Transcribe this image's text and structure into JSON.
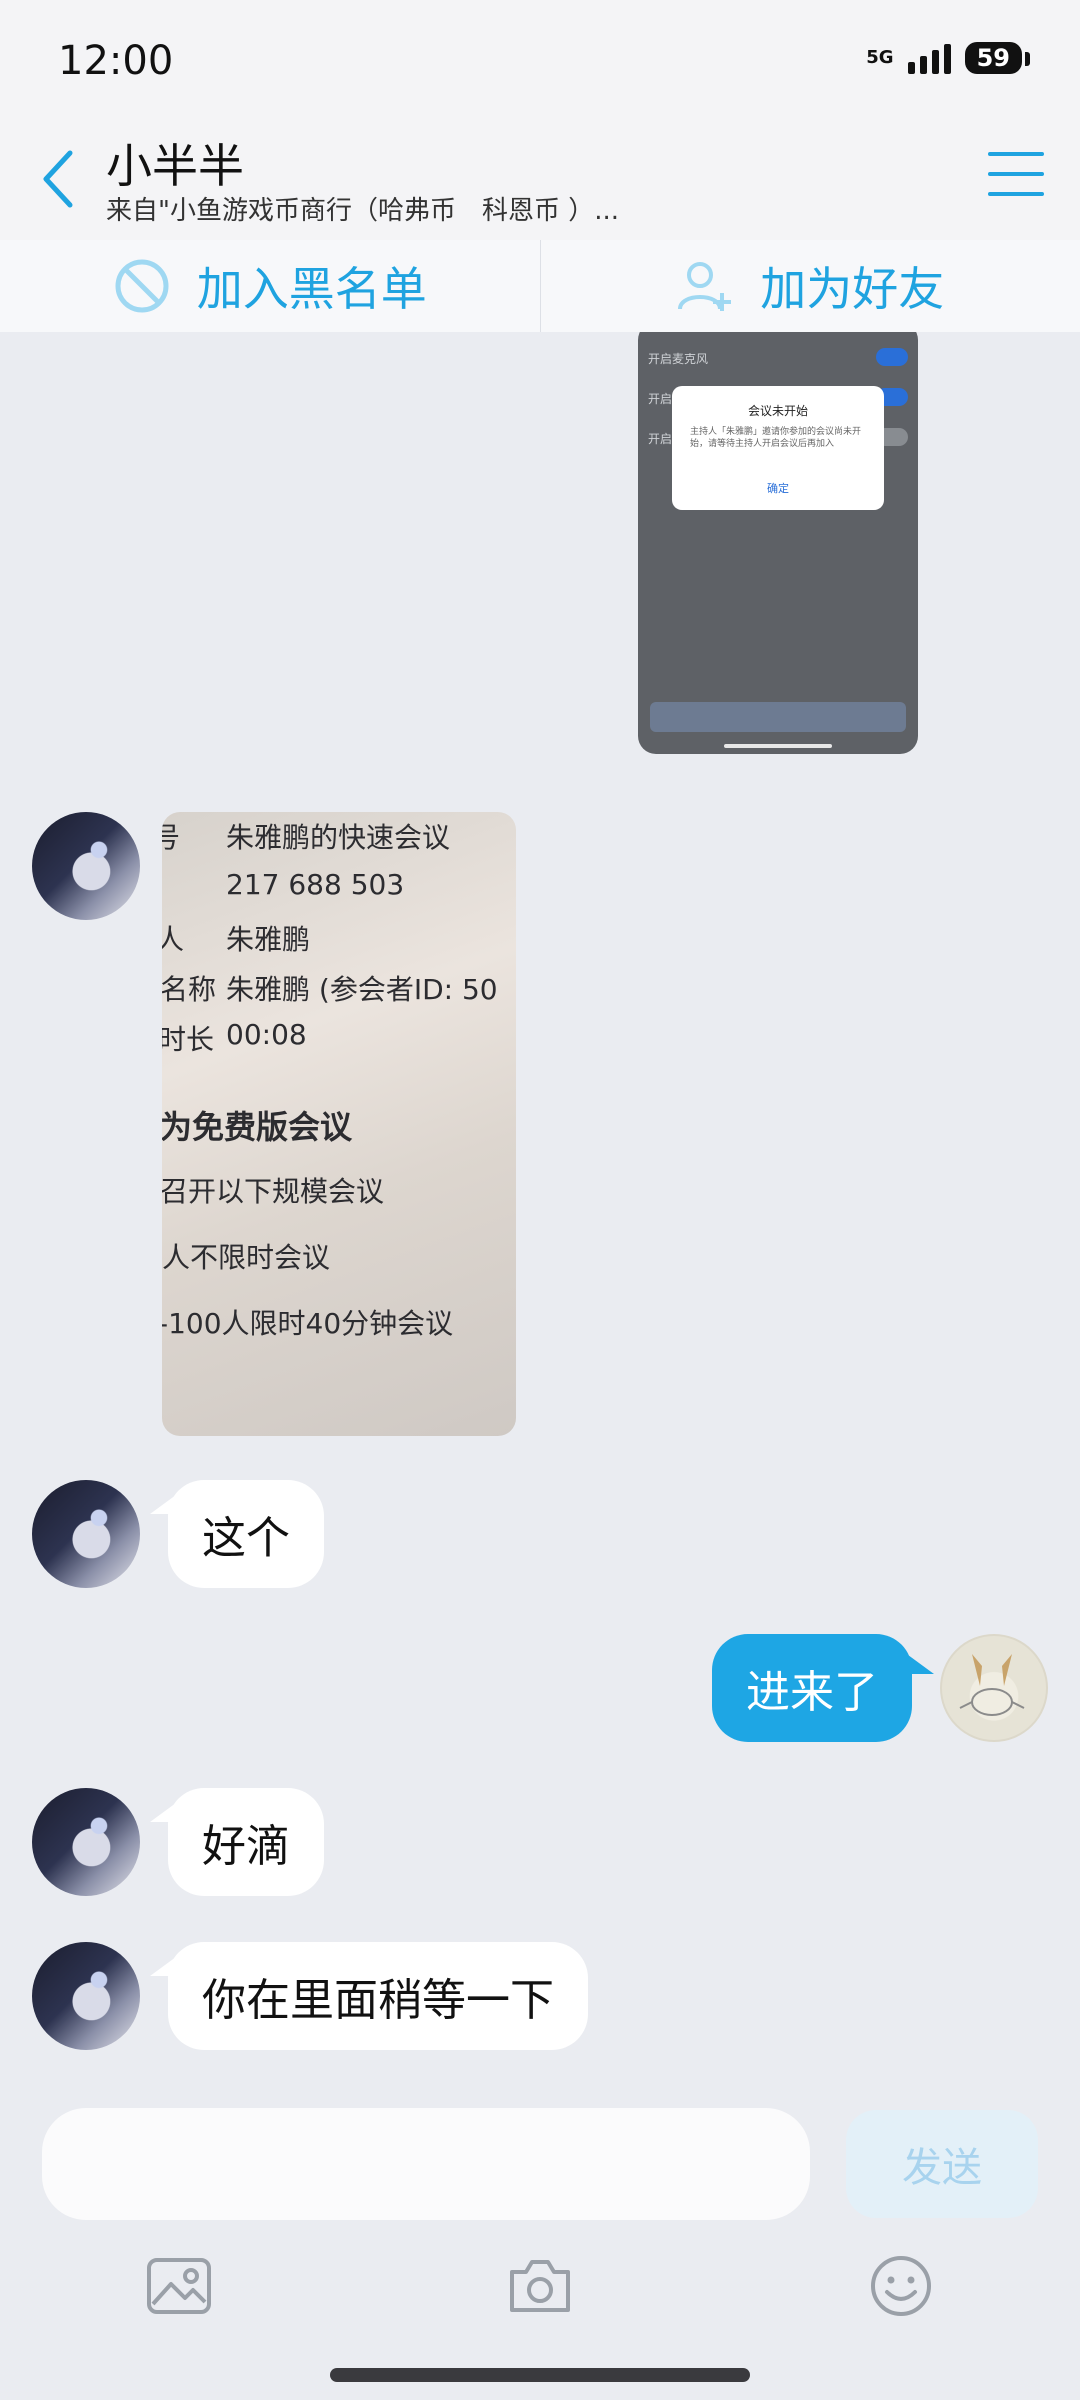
{
  "status_bar": {
    "time": "12:00",
    "network": "5G",
    "battery": "59"
  },
  "header": {
    "title": "小半半",
    "subtitle": "来自\"小鱼游戏币商行（哈弗币　科恩币 ）..."
  },
  "actions": {
    "block_label": "加入黑名单",
    "add_friend_label": "加为好友"
  },
  "image_message_1": {
    "rows": [
      "开启麦克风",
      "开启",
      "开启"
    ],
    "dialog_title": "会议未开始",
    "dialog_body": "主持人「朱雅鹏」邀请你参加的会议尚未开始，请等待主持人开启会议后再加入",
    "dialog_ok": "确定"
  },
  "image_message_2": {
    "lines": [
      "朱雅鹏的快速会议",
      "217 688 503",
      "朱雅鹏",
      "朱雅鹏  (参会者ID: 50",
      "00:08",
      "为免费版会议",
      "召开以下规模会议",
      "人不限时会议",
      "-100人限时40分钟会议"
    ],
    "side_labels": [
      "号",
      "人",
      "名称",
      "时长"
    ]
  },
  "messages": [
    {
      "side": "in",
      "text": "这个"
    },
    {
      "side": "out",
      "text": "进来了"
    },
    {
      "side": "in",
      "text": "好滴"
    },
    {
      "side": "in",
      "text": "你在里面稍等一下"
    }
  ],
  "composer": {
    "input_value": "",
    "send_label": "发送"
  },
  "toolbar": {
    "icons": [
      "image-icon",
      "camera-icon",
      "emoji-icon"
    ]
  },
  "colors": {
    "accent": "#1fa3e0",
    "outgoing_bubble": "#1ea6e4",
    "background": "#eaecf1"
  }
}
